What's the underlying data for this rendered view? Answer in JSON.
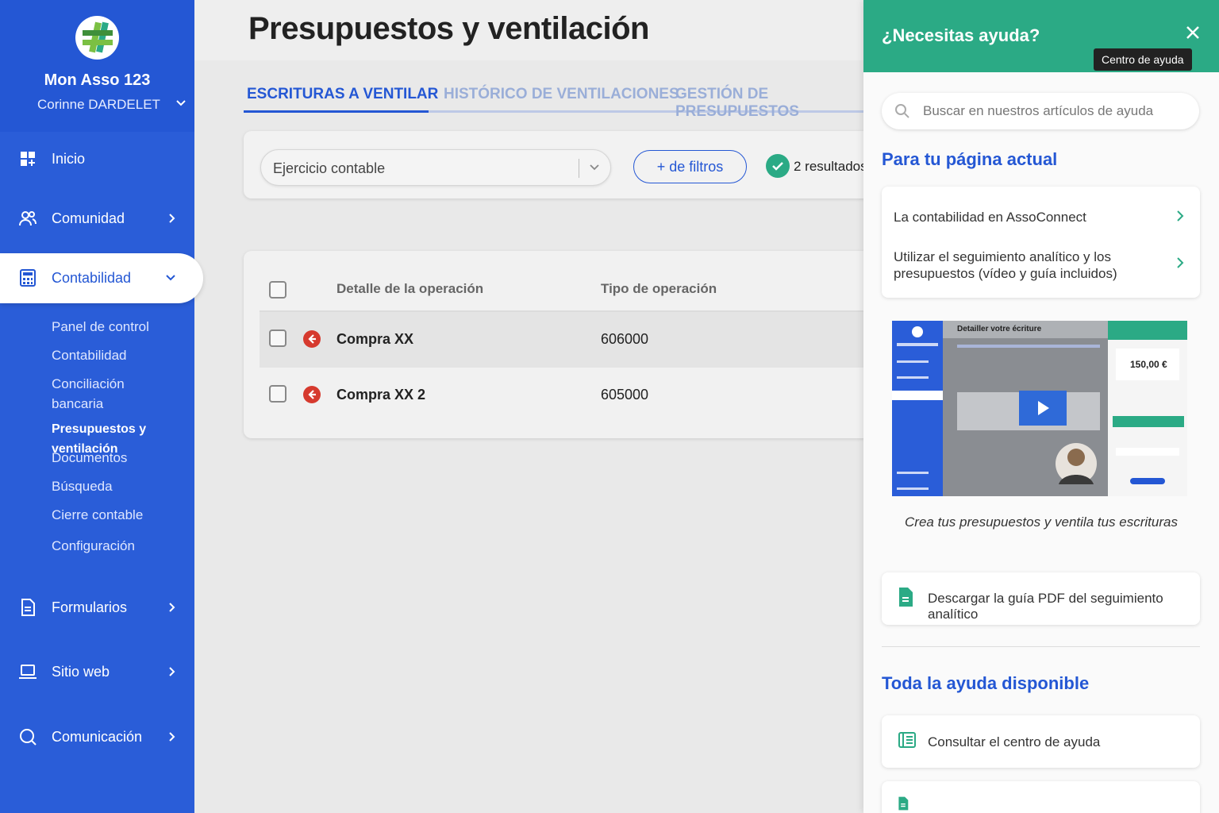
{
  "sidebar": {
    "org_name": "Mon Asso 123",
    "user_name": "Corinne DARDELET",
    "items": [
      {
        "label": "Inicio",
        "icon": "dashboard-icon"
      },
      {
        "label": "Comunidad",
        "icon": "users-icon"
      },
      {
        "label": "Contabilidad",
        "icon": "calculator-icon"
      },
      {
        "label": "Formularios",
        "icon": "document-icon"
      },
      {
        "label": "Sitio web",
        "icon": "laptop-icon"
      },
      {
        "label": "Comunicación",
        "icon": "chat-icon"
      }
    ],
    "subitems": [
      "Panel de control",
      "Contabilidad",
      "Conciliación bancaria",
      "Presupuestos y ventilación",
      "Documentos",
      "Búsqueda",
      "Cierre contable",
      "Configuración"
    ]
  },
  "page": {
    "title": "Presupuestos y ventilación"
  },
  "tabs": [
    "ESCRITURAS A VENTILAR",
    "HISTÓRICO DE VENTILACIONES",
    "GESTIÓN DE PRESUPUESTOS"
  ],
  "filters": {
    "select_value": "Ejercicio contable",
    "more_filters": "+ de filtros",
    "results": "2 resultados"
  },
  "table": {
    "headers": [
      "Detalle de la operación",
      "Tipo de operación"
    ],
    "rows": [
      {
        "name": "Compra XX",
        "type": "606000"
      },
      {
        "name": "Compra XX 2",
        "type": "605000"
      }
    ]
  },
  "help": {
    "title": "¿Necesitas ayuda?",
    "tooltip": "Centro de ayuda",
    "search_placeholder": "Buscar en nuestros artículos de ayuda",
    "current_page_title": "Para tu página actual",
    "links": [
      "La contabilidad en AssoConnect",
      "Utilizar el seguimiento analítico y los presupuestos (vídeo y guía incluidos)"
    ],
    "video_caption": "Crea tus presupuestos y ventila tus escrituras",
    "video_inner": {
      "header": "Detailler votre écriture",
      "amount": "150,00 €"
    },
    "pdf_link": "Descargar la guía PDF del seguimiento analítico",
    "all_help_title": "Toda la ayuda disponible",
    "help_center_link": "Consultar el centro de ayuda"
  },
  "colors": {
    "sidebar": "#2a5dd8",
    "accent": "#2457d4",
    "help_green": "#2baa85",
    "danger": "#d63a2e"
  }
}
